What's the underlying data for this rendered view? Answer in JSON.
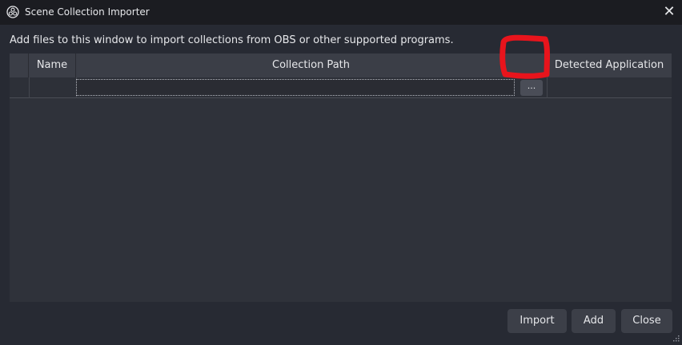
{
  "window": {
    "title": "Scene Collection Importer",
    "close_glyph": "✕"
  },
  "description": "Add files to this window to import collections from OBS or other supported programs.",
  "table": {
    "columns": [
      "",
      "Name",
      "Collection Path",
      "Detected Application"
    ],
    "rows": [
      {
        "name": "",
        "path": "",
        "browse_label": "...",
        "detected_app": ""
      }
    ]
  },
  "buttons": {
    "import": "Import",
    "add": "Add",
    "close": "Close"
  },
  "colors": {
    "annotation": "#e8141c",
    "window_bg": "#272a33",
    "header_bg": "#3b3e47"
  },
  "icons": [
    "obs-logo-icon",
    "close-icon",
    "resize-grip-icon"
  ]
}
